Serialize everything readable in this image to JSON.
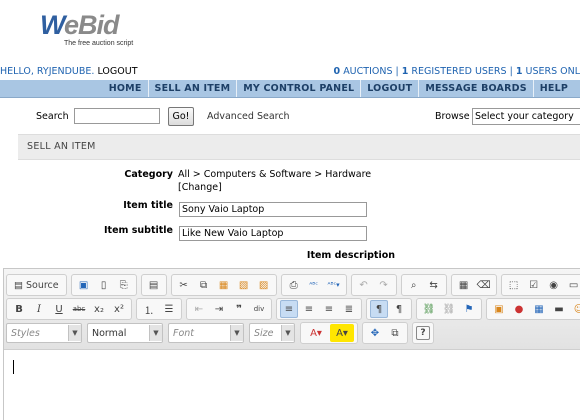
{
  "logo": {
    "main_w": "W",
    "main_rest": "eBid",
    "tagline": "The free auction script"
  },
  "user": {
    "hello": "HELLO, RYJENDUBE.",
    "logout": "LOGOUT"
  },
  "stats": {
    "auctions_count": "0",
    "auctions_label": "AUCTIONS",
    "registered_count": "1",
    "registered_label": "REGISTERED USERS",
    "online_count": "1",
    "online_label": "USERS ONL"
  },
  "nav": [
    "HOME",
    "SELL AN ITEM",
    "MY CONTROL PANEL",
    "LOGOUT",
    "MESSAGE BOARDS",
    "HELP"
  ],
  "search": {
    "label": "Search",
    "go": "Go!",
    "advanced": "Advanced Search",
    "browse_label": "Browse",
    "browse_value": "Select your category"
  },
  "section": {
    "title": "SELL AN ITEM"
  },
  "form": {
    "category_label": "Category",
    "category_value": "All > Computers & Software > Hardware",
    "change": "[Change]",
    "title_label": "Item title",
    "title_value": "Sony Vaio Laptop",
    "subtitle_label": "Item subtitle",
    "subtitle_value": "Like New Vaio Laptop",
    "description_label": "Item description"
  },
  "editor": {
    "source_label": "Source",
    "styles_label": "Styles",
    "format_label": "Normal",
    "font_label": "Font",
    "size_label": "Size"
  }
}
